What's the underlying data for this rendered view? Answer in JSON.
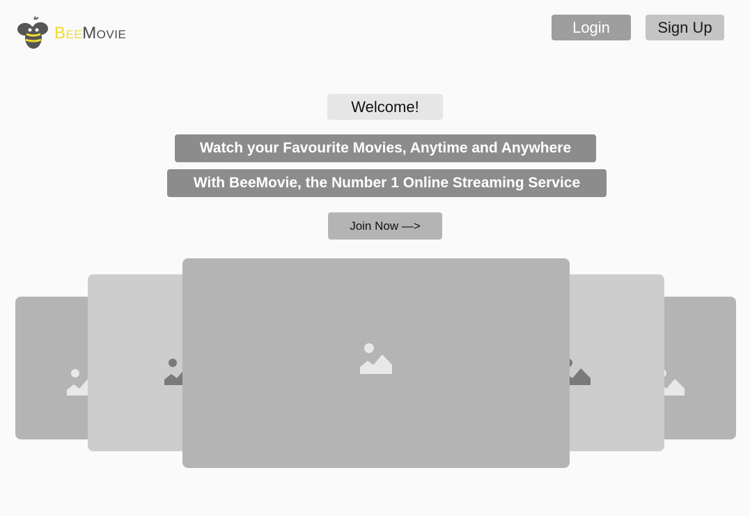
{
  "brand": {
    "name_part1": "Bee",
    "name_part2": "Movie",
    "logo_icon": "bee-logo-icon",
    "colors": {
      "accent": "#f0dc2c",
      "text": "#4a4a4a"
    }
  },
  "header": {
    "login_label": "Login",
    "signup_label": "Sign Up"
  },
  "hero": {
    "welcome": "Welcome!",
    "tagline1": "Watch your Favourite Movies, Anytime and Anywhere",
    "tagline2": "With BeeMovie, the Number 1 Online Streaming Service",
    "cta_label": "Join Now —>"
  },
  "carousel": {
    "icon": "image-placeholder-icon",
    "items": [
      {
        "name": "carousel-card-far-left"
      },
      {
        "name": "carousel-card-left"
      },
      {
        "name": "carousel-card-center"
      },
      {
        "name": "carousel-card-right"
      },
      {
        "name": "carousel-card-far-right"
      }
    ]
  },
  "colors": {
    "background": "#fafafa",
    "login_button": "#9e9e9e",
    "signup_button": "#c4c4c4",
    "tagline_bg": "#8c8c8c",
    "welcome_bg": "#e6e6e6"
  }
}
